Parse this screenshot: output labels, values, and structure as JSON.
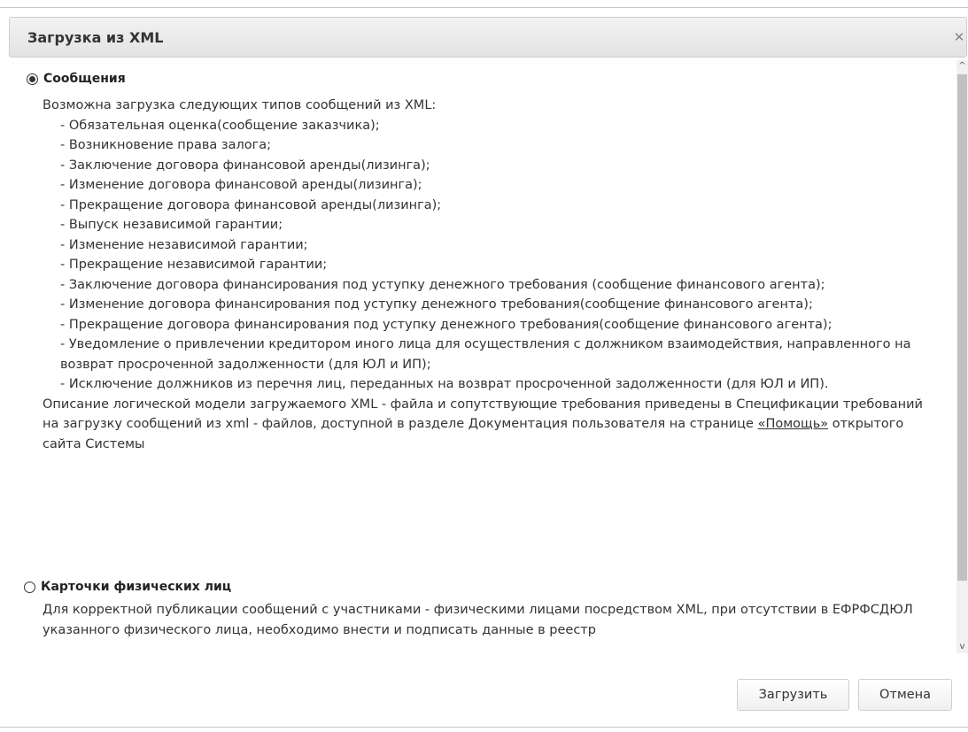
{
  "dialog": {
    "title": "Загрузка из XML",
    "close_glyph": "✕"
  },
  "section_messages": {
    "label": "Сообщения",
    "selected": true,
    "intro": "Возможна загрузка следующих типов сообщений из XML:",
    "items": [
      "- Обязательная оценка(сообщение заказчика);",
      "- Возникновение права залога;",
      "- Заключение договора финансовой аренды(лизинга);",
      "- Изменение договора финансовой аренды(лизинга);",
      "- Прекращение договора финансовой аренды(лизинга);",
      "- Выпуск независимой гарантии;",
      "- Изменение независимой гарантии;",
      "- Прекращение независимой гарантии;",
      "- Заключение договора финансирования под уступку денежного требования (сообщение финансового агента);",
      "- Изменение договора финансирования под уступку денежного требования(сообщение финансового агента);",
      "- Прекращение договора финансирования под уступку денежного требования(сообщение финансового агента);",
      "- Уведомление о привлечении кредитором иного лица для осуществления с должником взаимодействия, направленного на возврат просроченной задолженности (для ЮЛ и ИП);",
      "- Исключение должников из перечня лиц, переданных на возврат просроченной задолженности (для ЮЛ и ИП)."
    ],
    "description_before": "Описание логической модели загружаемого XML - файла и сопутствующие требования приведены в Спецификации требований на загрузку сообщений из xml - файлов, доступной в разделе Документация пользователя на странице ",
    "help_link": "«Помощь»",
    "description_after": " открытого сайта Системы"
  },
  "section_persons": {
    "label": "Карточки физических лиц",
    "selected": false,
    "text": "Для корректной публикации сообщений с участниками - физическими лицами посредством XML, при отсутствии в ЕФРФСДЮЛ указанного физического лица, необходимо внести и подписать данные в реестр"
  },
  "buttons": {
    "upload": "Загрузить",
    "cancel": "Отмена"
  },
  "scrollbar": {
    "up": "^",
    "down": "v"
  }
}
